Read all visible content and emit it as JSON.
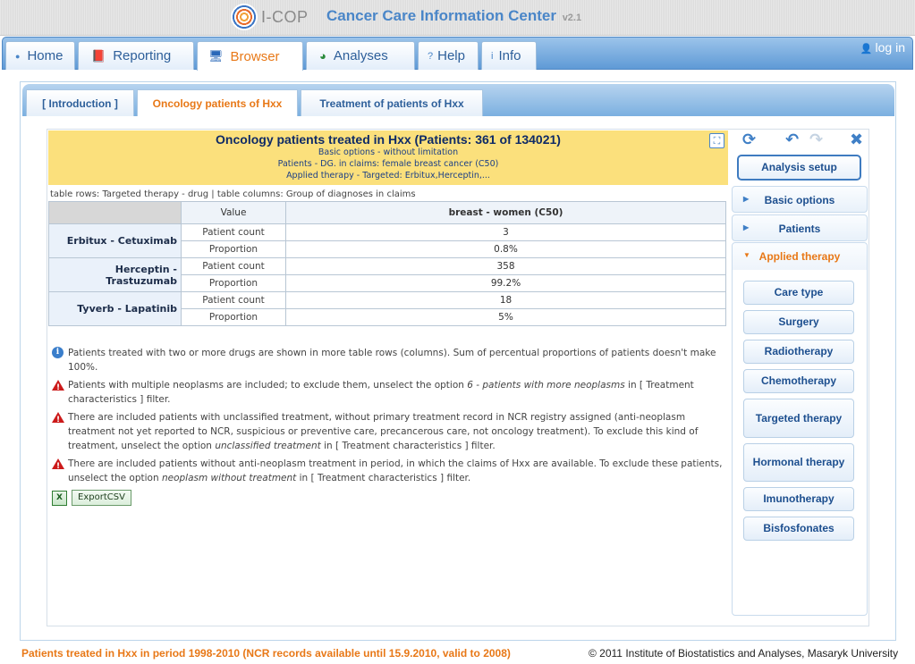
{
  "header": {
    "logo_text": "I-COP",
    "app_title": "Cancer Care Information Center",
    "app_version": "v2.1"
  },
  "nav": {
    "tabs": [
      {
        "label": "Home",
        "icon": "bullet-icon"
      },
      {
        "label": "Reporting",
        "icon": "book-icon"
      },
      {
        "label": "Browser",
        "icon": "monitor-icon",
        "active": true
      },
      {
        "label": "Analyses",
        "icon": "chart-icon"
      },
      {
        "label": "Help",
        "icon": "question-icon"
      },
      {
        "label": "Info",
        "icon": "info-icon"
      }
    ],
    "login_label": "log in"
  },
  "subtabs": [
    {
      "label": "[ Introduction ]"
    },
    {
      "label": "Oncology patients of Hxx",
      "active": true
    },
    {
      "label": "Treatment of patients of Hxx"
    }
  ],
  "report": {
    "title": "Oncology patients treated in Hxx (Patients: 361 of 134021)",
    "subtitles": [
      "Basic options - without limitation",
      "Patients - DG. in claims: female breast cancer (C50)",
      "Applied therapy - Targeted: Erbitux,Herceptin,..."
    ],
    "rows_cols_desc": "table rows: Targeted therapy - drug | table columns: Group of diagnoses in claims",
    "table": {
      "value_header": "Value",
      "column_header": "breast - women (C50)",
      "rows": [
        {
          "drug": "Erbitux - Cetuximab",
          "patient_count_label": "Patient count",
          "patient_count": "3",
          "proportion_label": "Proportion",
          "proportion": "0.8%"
        },
        {
          "drug": "Herceptin - Trastuzumab",
          "patient_count_label": "Patient count",
          "patient_count": "358",
          "proportion_label": "Proportion",
          "proportion": "99.2%"
        },
        {
          "drug": "Tyverb - Lapatinib",
          "patient_count_label": "Patient count",
          "patient_count": "18",
          "proportion_label": "Proportion",
          "proportion": "5%"
        }
      ]
    },
    "notes": {
      "n1": "Patients treated with two or more drugs are shown in more table rows (columns). Sum of percentual proportions of patients doesn't make 100%.",
      "n2_a": "Patients with multiple neoplasms are included; to exclude them, unselect the option ",
      "n2_em": "6 - patients with more neoplasms",
      "n2_b": " in [ Treatment characteristics ] filter.",
      "n3_a": "There are included patients with unclassified treatment, without primary treatment record in NCR registry assigned (anti-neoplasm treatment not yet reported to NCR, suspicious or preventive care, precancerous care, not oncology treatment). To exclude this kind of treatment, unselect the option ",
      "n3_em": "unclassified treatment",
      "n3_b": " in [ Treatment characteristics ] filter.",
      "n4_a": "There are included patients without anti-neoplasm treatment in period, in which the claims of Hxx are available. To exclude these patients, unselect the option ",
      "n4_em": "neoplasm without treatment",
      "n4_b": " in [ Treatment characteristics ] filter."
    },
    "export_label": "ExportCSV"
  },
  "sidepanel": {
    "analysis_setup": "Analysis setup",
    "sections": {
      "basic": "Basic options",
      "patients": "Patients",
      "applied": "Applied therapy"
    },
    "therapy_options": [
      "Care type",
      "Surgery",
      "Radiotherapy",
      "Chemotherapy",
      "Targeted therapy",
      "Hormonal therapy",
      "Imunotherapy",
      "Bisfosfonates"
    ]
  },
  "footer": {
    "left": "Patients treated in Hxx in period 1998-2010 (NCR records available until 15.9.2010, valid to 2008)",
    "right": "© 2011 Institute of Biostatistics and Analyses, Masaryk University"
  },
  "colors": {
    "accent_orange": "#e87817",
    "nav_blue": "#5f9ad6",
    "title_yellow": "#fbe07c",
    "warning_red": "#cc1a1a"
  }
}
